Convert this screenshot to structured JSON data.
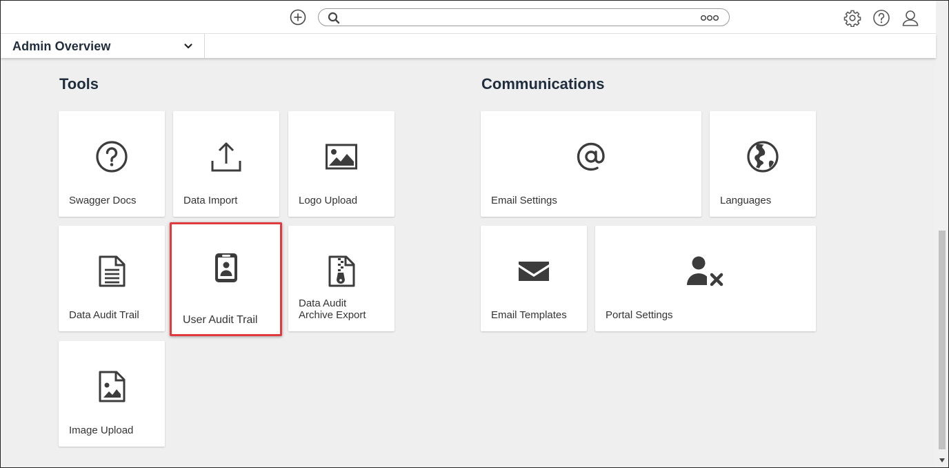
{
  "topbar": {
    "add_icon": "plus-circle-icon",
    "search": {
      "placeholder": "",
      "value": ""
    },
    "icons": [
      "gear-icon",
      "help-icon",
      "user-icon"
    ]
  },
  "subbar": {
    "dropdown_label": "Admin Overview"
  },
  "tools": {
    "title": "Tools",
    "tiles": [
      {
        "label": "Swagger Docs",
        "icon": "question-circle-icon"
      },
      {
        "label": "Data Import",
        "icon": "upload-icon"
      },
      {
        "label": "Logo Upload",
        "icon": "image-icon"
      },
      {
        "label": "Data Audit Trail",
        "icon": "document-icon"
      },
      {
        "label": "User Audit Trail",
        "icon": "id-badge-icon",
        "highlighted": true
      },
      {
        "label_line1": "Data Audit",
        "label_line2": "Archive Export",
        "icon": "zip-file-icon"
      },
      {
        "label": "Image Upload",
        "icon": "image-file-icon"
      }
    ]
  },
  "communications": {
    "title": "Communications",
    "tiles": [
      {
        "label": "Email Settings",
        "icon": "at-sign-icon"
      },
      {
        "label": "Languages",
        "icon": "globe-icon"
      },
      {
        "label": "Email Templates",
        "icon": "envelope-icon"
      },
      {
        "label": "Portal Settings",
        "icon": "user-remove-icon"
      }
    ]
  },
  "colors": {
    "highlight": "#e0393e",
    "icon": "#3c3c3c",
    "heading": "#1f2d3d",
    "background": "#efefef"
  }
}
